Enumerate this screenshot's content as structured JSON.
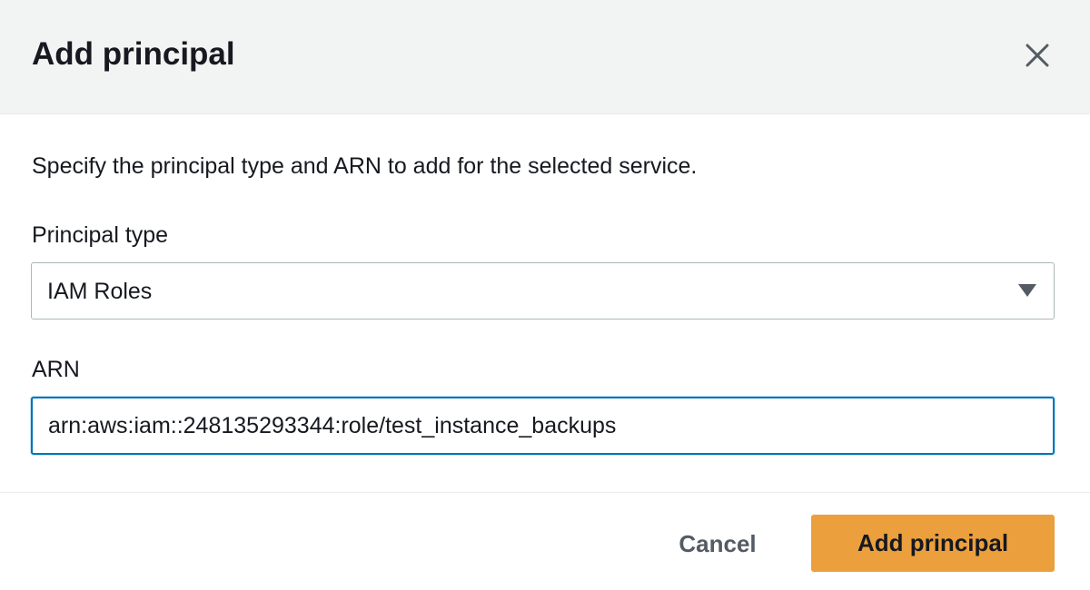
{
  "modal": {
    "title": "Add principal",
    "close_icon": "close-icon",
    "description": "Specify the principal type and ARN to add for the selected service."
  },
  "principal_type": {
    "label": "Principal type",
    "selected": "IAM Roles",
    "caret_icon": "caret-down-icon"
  },
  "arn": {
    "label": "ARN",
    "value": "arn:aws:iam::248135293344:role/test_instance_backups"
  },
  "footer": {
    "cancel_label": "Cancel",
    "submit_label": "Add principal"
  },
  "colors": {
    "header_bg": "#f2f3f3",
    "primary_button": "#ec9f3d",
    "focus_border": "#0073bb",
    "text": "#16191f",
    "secondary_text": "#545b64"
  }
}
